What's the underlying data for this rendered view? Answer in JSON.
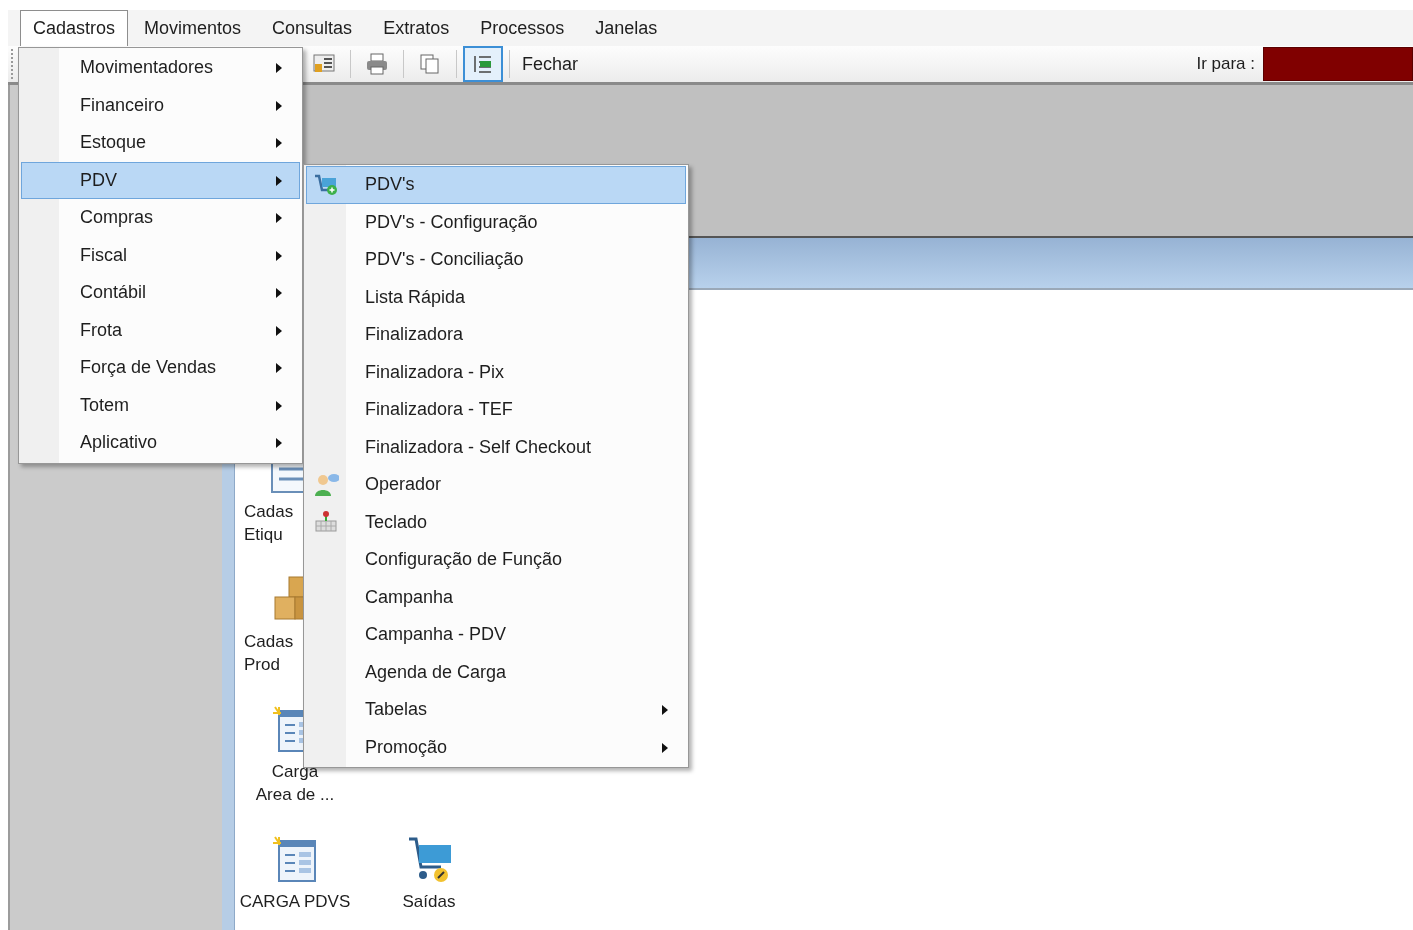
{
  "menubar": [
    {
      "label": "Cadastros",
      "selected": true
    },
    {
      "label": "Movimentos",
      "selected": false
    },
    {
      "label": "Consultas",
      "selected": false
    },
    {
      "label": "Extratos",
      "selected": false
    },
    {
      "label": "Processos",
      "selected": false
    },
    {
      "label": "Janelas",
      "selected": false
    }
  ],
  "toolbar": {
    "tools": [
      {
        "kind": "lock-numbers",
        "selected": false
      },
      {
        "kind": "printer",
        "selected": false
      },
      {
        "kind": "copy",
        "selected": false
      },
      {
        "kind": "list",
        "selected": true
      }
    ],
    "close_label": "Fechar",
    "goto_label": "Ir para :"
  },
  "menu": [
    {
      "label": "Movimentadores",
      "selected": false,
      "submenu": true
    },
    {
      "label": "Financeiro",
      "selected": false,
      "submenu": true
    },
    {
      "label": "Estoque",
      "selected": false,
      "submenu": true
    },
    {
      "label": "PDV",
      "selected": true,
      "submenu": true
    },
    {
      "label": "Compras",
      "selected": false,
      "submenu": true
    },
    {
      "label": "Fiscal",
      "selected": false,
      "submenu": true
    },
    {
      "label": "Contábil",
      "selected": false,
      "submenu": true
    },
    {
      "label": "Frota",
      "selected": false,
      "submenu": true
    },
    {
      "label": "Força de Vendas",
      "selected": false,
      "submenu": true
    },
    {
      "label": "Totem",
      "selected": false,
      "submenu": true
    },
    {
      "label": "Aplicativo",
      "selected": false,
      "submenu": true
    }
  ],
  "submenu": [
    {
      "label": "PDV's",
      "selected": true,
      "submenu": false,
      "kind": "cart"
    },
    {
      "label": "PDV's - Configuração",
      "selected": false,
      "submenu": false,
      "kind": "plain"
    },
    {
      "label": "PDV's - Conciliação",
      "selected": false,
      "submenu": false,
      "kind": "plain"
    },
    {
      "label": "Lista Rápida",
      "selected": false,
      "submenu": false,
      "kind": "plain"
    },
    {
      "label": "Finalizadora",
      "selected": false,
      "submenu": false,
      "kind": "plain"
    },
    {
      "label": "Finalizadora - Pix",
      "selected": false,
      "submenu": false,
      "kind": "plain"
    },
    {
      "label": "Finalizadora - TEF",
      "selected": false,
      "submenu": false,
      "kind": "plain"
    },
    {
      "label": "Finalizadora - Self Checkout",
      "selected": false,
      "submenu": false,
      "kind": "plain"
    },
    {
      "label": "Operador",
      "selected": false,
      "submenu": false,
      "kind": "user"
    },
    {
      "label": "Teclado",
      "selected": false,
      "submenu": false,
      "kind": "keypad"
    },
    {
      "label": "Configuração de Função",
      "selected": false,
      "submenu": false,
      "kind": "plain"
    },
    {
      "label": "Campanha",
      "selected": false,
      "submenu": false,
      "kind": "plain"
    },
    {
      "label": "Campanha - PDV",
      "selected": false,
      "submenu": false,
      "kind": "plain"
    },
    {
      "label": "Agenda de Carga",
      "selected": false,
      "submenu": false,
      "kind": "plain"
    },
    {
      "label": "Tabelas",
      "selected": false,
      "submenu": true,
      "kind": "plain"
    },
    {
      "label": "Promoção",
      "selected": false,
      "submenu": true,
      "kind": "plain"
    }
  ],
  "shortcuts": [
    {
      "kind": "document",
      "lines": [
        "Cadas",
        "Etiqu"
      ]
    },
    {
      "kind": "boxes",
      "lines": [
        "Cadas",
        "Prod"
      ]
    },
    {
      "kind": "form",
      "lines": [
        "Carga",
        "Area de ..."
      ]
    },
    {
      "kind": "form",
      "lines": [
        "CARGA PDVS"
      ]
    },
    {
      "kind": "cart",
      "lines": [
        "Saídas"
      ]
    }
  ]
}
